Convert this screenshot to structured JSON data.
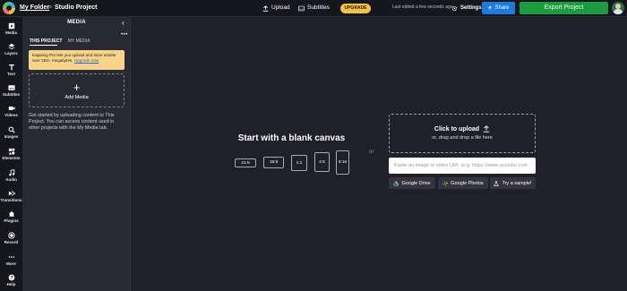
{
  "header": {
    "folder": "My Folder",
    "separator": ">",
    "project": "Studio Project",
    "upload": "Upload",
    "subtitles": "Subtitles",
    "upgrade": "UPGRADE",
    "last_edited": "Last edited a few seconds ago",
    "settings": "Settings",
    "share": "Share",
    "export": "Export Project"
  },
  "rail": {
    "items": [
      {
        "label": "Media",
        "icon": "media-icon"
      },
      {
        "label": "Layers",
        "icon": "layers-icon"
      },
      {
        "label": "Text",
        "icon": "text-icon"
      },
      {
        "label": "Subtitles",
        "icon": "subtitles-icon"
      },
      {
        "label": "Videos",
        "icon": "videos-icon"
      },
      {
        "label": "Images",
        "icon": "images-icon"
      },
      {
        "label": "Elements",
        "icon": "elements-icon"
      },
      {
        "label": "Audio",
        "icon": "audio-icon"
      },
      {
        "label": "Transitions",
        "icon": "transitions-icon"
      },
      {
        "label": "Plugins",
        "icon": "plugins-icon"
      },
      {
        "label": "Record",
        "icon": "record-icon"
      },
      {
        "label": "More",
        "icon": "more-icon"
      },
      {
        "label": "Help",
        "icon": "help-icon"
      }
    ]
  },
  "panel": {
    "title": "MEDIA",
    "collapse": "‹",
    "more": "•••",
    "tabs": [
      "THIS PROJECT",
      "MY MEDIA"
    ],
    "promo_text": "Kapwing Pro lets you upload and store assets over 250+ megabytes.",
    "promo_link": "Upgrade now",
    "add_media": "Add Media",
    "help_text": "Get started by uploading content to This Project. You can access content used in other projects with the My Media tab."
  },
  "canvas": {
    "title": "Start with a blank canvas",
    "ratios": [
      "21:9",
      "16:9",
      "1:1",
      "4:5",
      "9:16"
    ],
    "or": "or",
    "upload_title": "Click to upload",
    "upload_sub": "or, drag and drop a file here",
    "url_placeholder": "Paste an image or video URL (e.g. https://www.youtube.com",
    "google_drive": "Google Drive",
    "google_photos": "Google Photos",
    "try_sample": "Try a sample!"
  },
  "colors": {
    "background": "#1f2029",
    "share": "#1f7ae0",
    "export": "#1d9b3f",
    "upgrade": "#f5c242",
    "promo": "#f7d489"
  }
}
